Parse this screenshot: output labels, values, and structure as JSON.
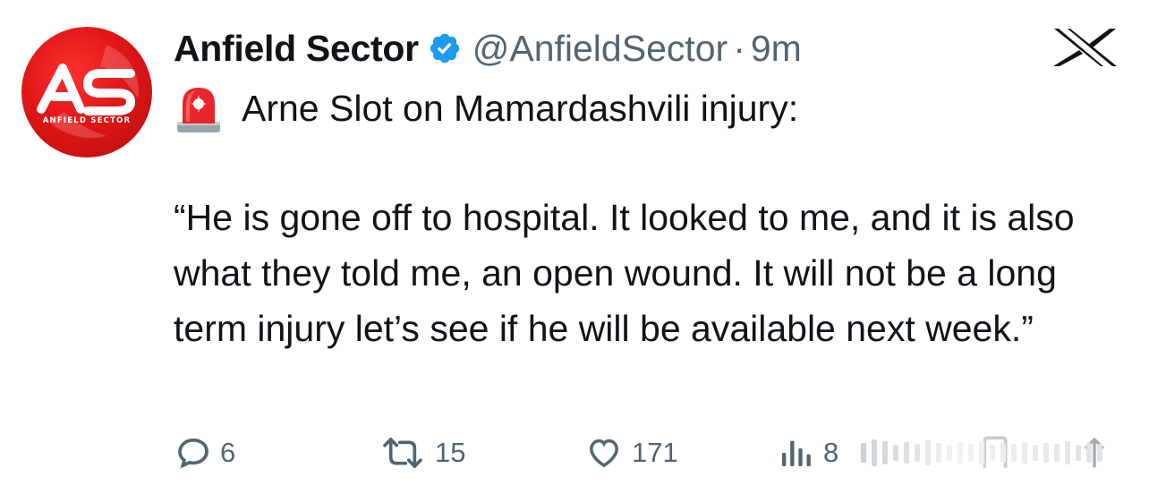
{
  "tweet": {
    "author": {
      "display_name": "Anfield Sector",
      "handle": "@AnfieldSector",
      "separator": "·",
      "time": "9m",
      "verified": true,
      "verified_icon": "verified-badge-icon",
      "avatar_text": "ANFIELD SECTOR",
      "avatar_color": "#e01616"
    },
    "platform_icon": "x-logo-icon",
    "lead_emoji": "rotating-light-icon",
    "lead_text": "Arne Slot on Mamardashvili injury:",
    "quote": "“He is gone off to hospital. It looked to me, and it is also what they told me, an open wound. It will not be a long term injury let’s see if he will be available next week.”",
    "actions": {
      "replies": "6",
      "reposts": "15",
      "likes": "171",
      "views": "8"
    }
  },
  "colors": {
    "text_primary": "#0f1419",
    "text_secondary": "#536471",
    "verified_blue": "#1d9bf0"
  }
}
